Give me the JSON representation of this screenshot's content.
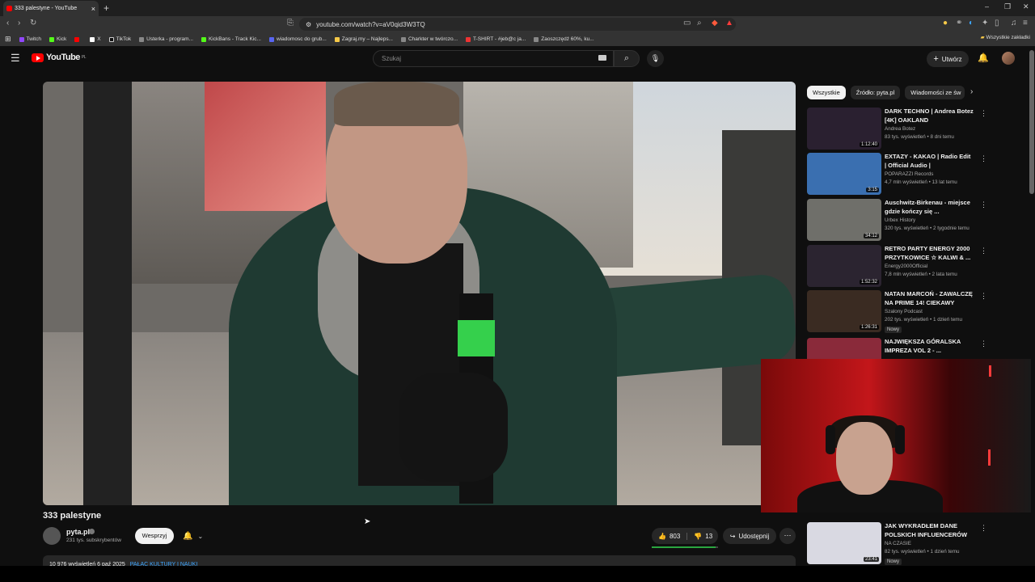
{
  "browser": {
    "tab_title": "333 palestyne - YouTube",
    "tab_close": "×",
    "new_tab": "+",
    "url": "youtube.com/watch?v=aV0qid3W3TQ",
    "bookmarks": [
      "Twitch",
      "Kick",
      "",
      "X",
      "TikTok",
      "Usterka - program...",
      "KickBans - Track Kic...",
      "wiadomosc do grub...",
      "Zagraj.my – Najleps...",
      "Charkter w twórczo...",
      "T-SHIRT - #jeb@c ja...",
      "Zaoszczędź 60%, ku..."
    ],
    "all_bookmarks": "Wszystkie zakładki"
  },
  "yt": {
    "logo": "YouTube",
    "region": "PL",
    "search_placeholder": "Szukaj",
    "create": "Utwórz"
  },
  "video": {
    "title": "333 palestyne",
    "channel": "pyta.pl",
    "subs": "231 tys. subskrybentów",
    "support": "Wesprzyj",
    "likes": "803",
    "dislikes": "13",
    "share": "Udostępnij",
    "desc_meta": "10 976 wyświetleń  6 paź 2025",
    "desc_tag": "PAŁAC KULTURY I NAUKI"
  },
  "chips": [
    "Wszystkie",
    "Źródło: pyta.pl",
    "Wiadomości ze św"
  ],
  "recommendations": [
    {
      "title": "DARK TECHNO | Andrea Botez [4K] OAKLAND",
      "channel": "Andrea Botez",
      "meta": "83 tys. wyświetleń • 8 dni temu",
      "duration": "1:12:40",
      "badge": "",
      "color": "#2a2030"
    },
    {
      "title": "EXTAZY - KAKAO | Radio Edit | Official Audio |",
      "channel": "POPARAZZI Records",
      "meta": "4,7 mln wyświetleń • 13 lat temu",
      "duration": "3:15",
      "badge": "",
      "color": "#3a6fb0"
    },
    {
      "title": "Auschwitz-Birkenau - miejsce gdzie kończy się ...",
      "channel": "Urbex History",
      "meta": "320 tys. wyświetleń • 2 tygodnie temu",
      "duration": "34:12",
      "badge": "",
      "color": "#6f6f6a"
    },
    {
      "title": "RETRO PARTY ENERGY 2000 PRZYTKOWICE ☆ KALWI & ...",
      "channel": "Energy2000Official",
      "meta": "7,8 mln wyświetleń • 2 lata temu",
      "duration": "1:52:32",
      "badge": "",
      "color": "#2b2430"
    },
    {
      "title": "NATAN MARCOŃ - ZAWALCZĘ NA PRIME 14! CIEKAWY FILMI...",
      "channel": "Szalony Podcast",
      "meta": "202 tys. wyświetleń • 1 dzień temu",
      "duration": "1:26:31",
      "badge": "Nowy",
      "color": "#3a2b22"
    },
    {
      "title": "NAJWIĘKSZA GÓRALSKA IMPREZA VOL 2 - ...",
      "channel": "",
      "meta": "",
      "duration": "",
      "badge": "",
      "color": "#8a2a3a"
    },
    {
      "title": "JAK WYKRADŁEM DANE POLSKICH INFLUENCERÓW",
      "channel": "NA CZASIE",
      "meta": "82 tys. wyświetleń • 1 dzień temu",
      "duration": "23:41",
      "badge": "Nowy",
      "color": "#d9d9e2"
    }
  ]
}
